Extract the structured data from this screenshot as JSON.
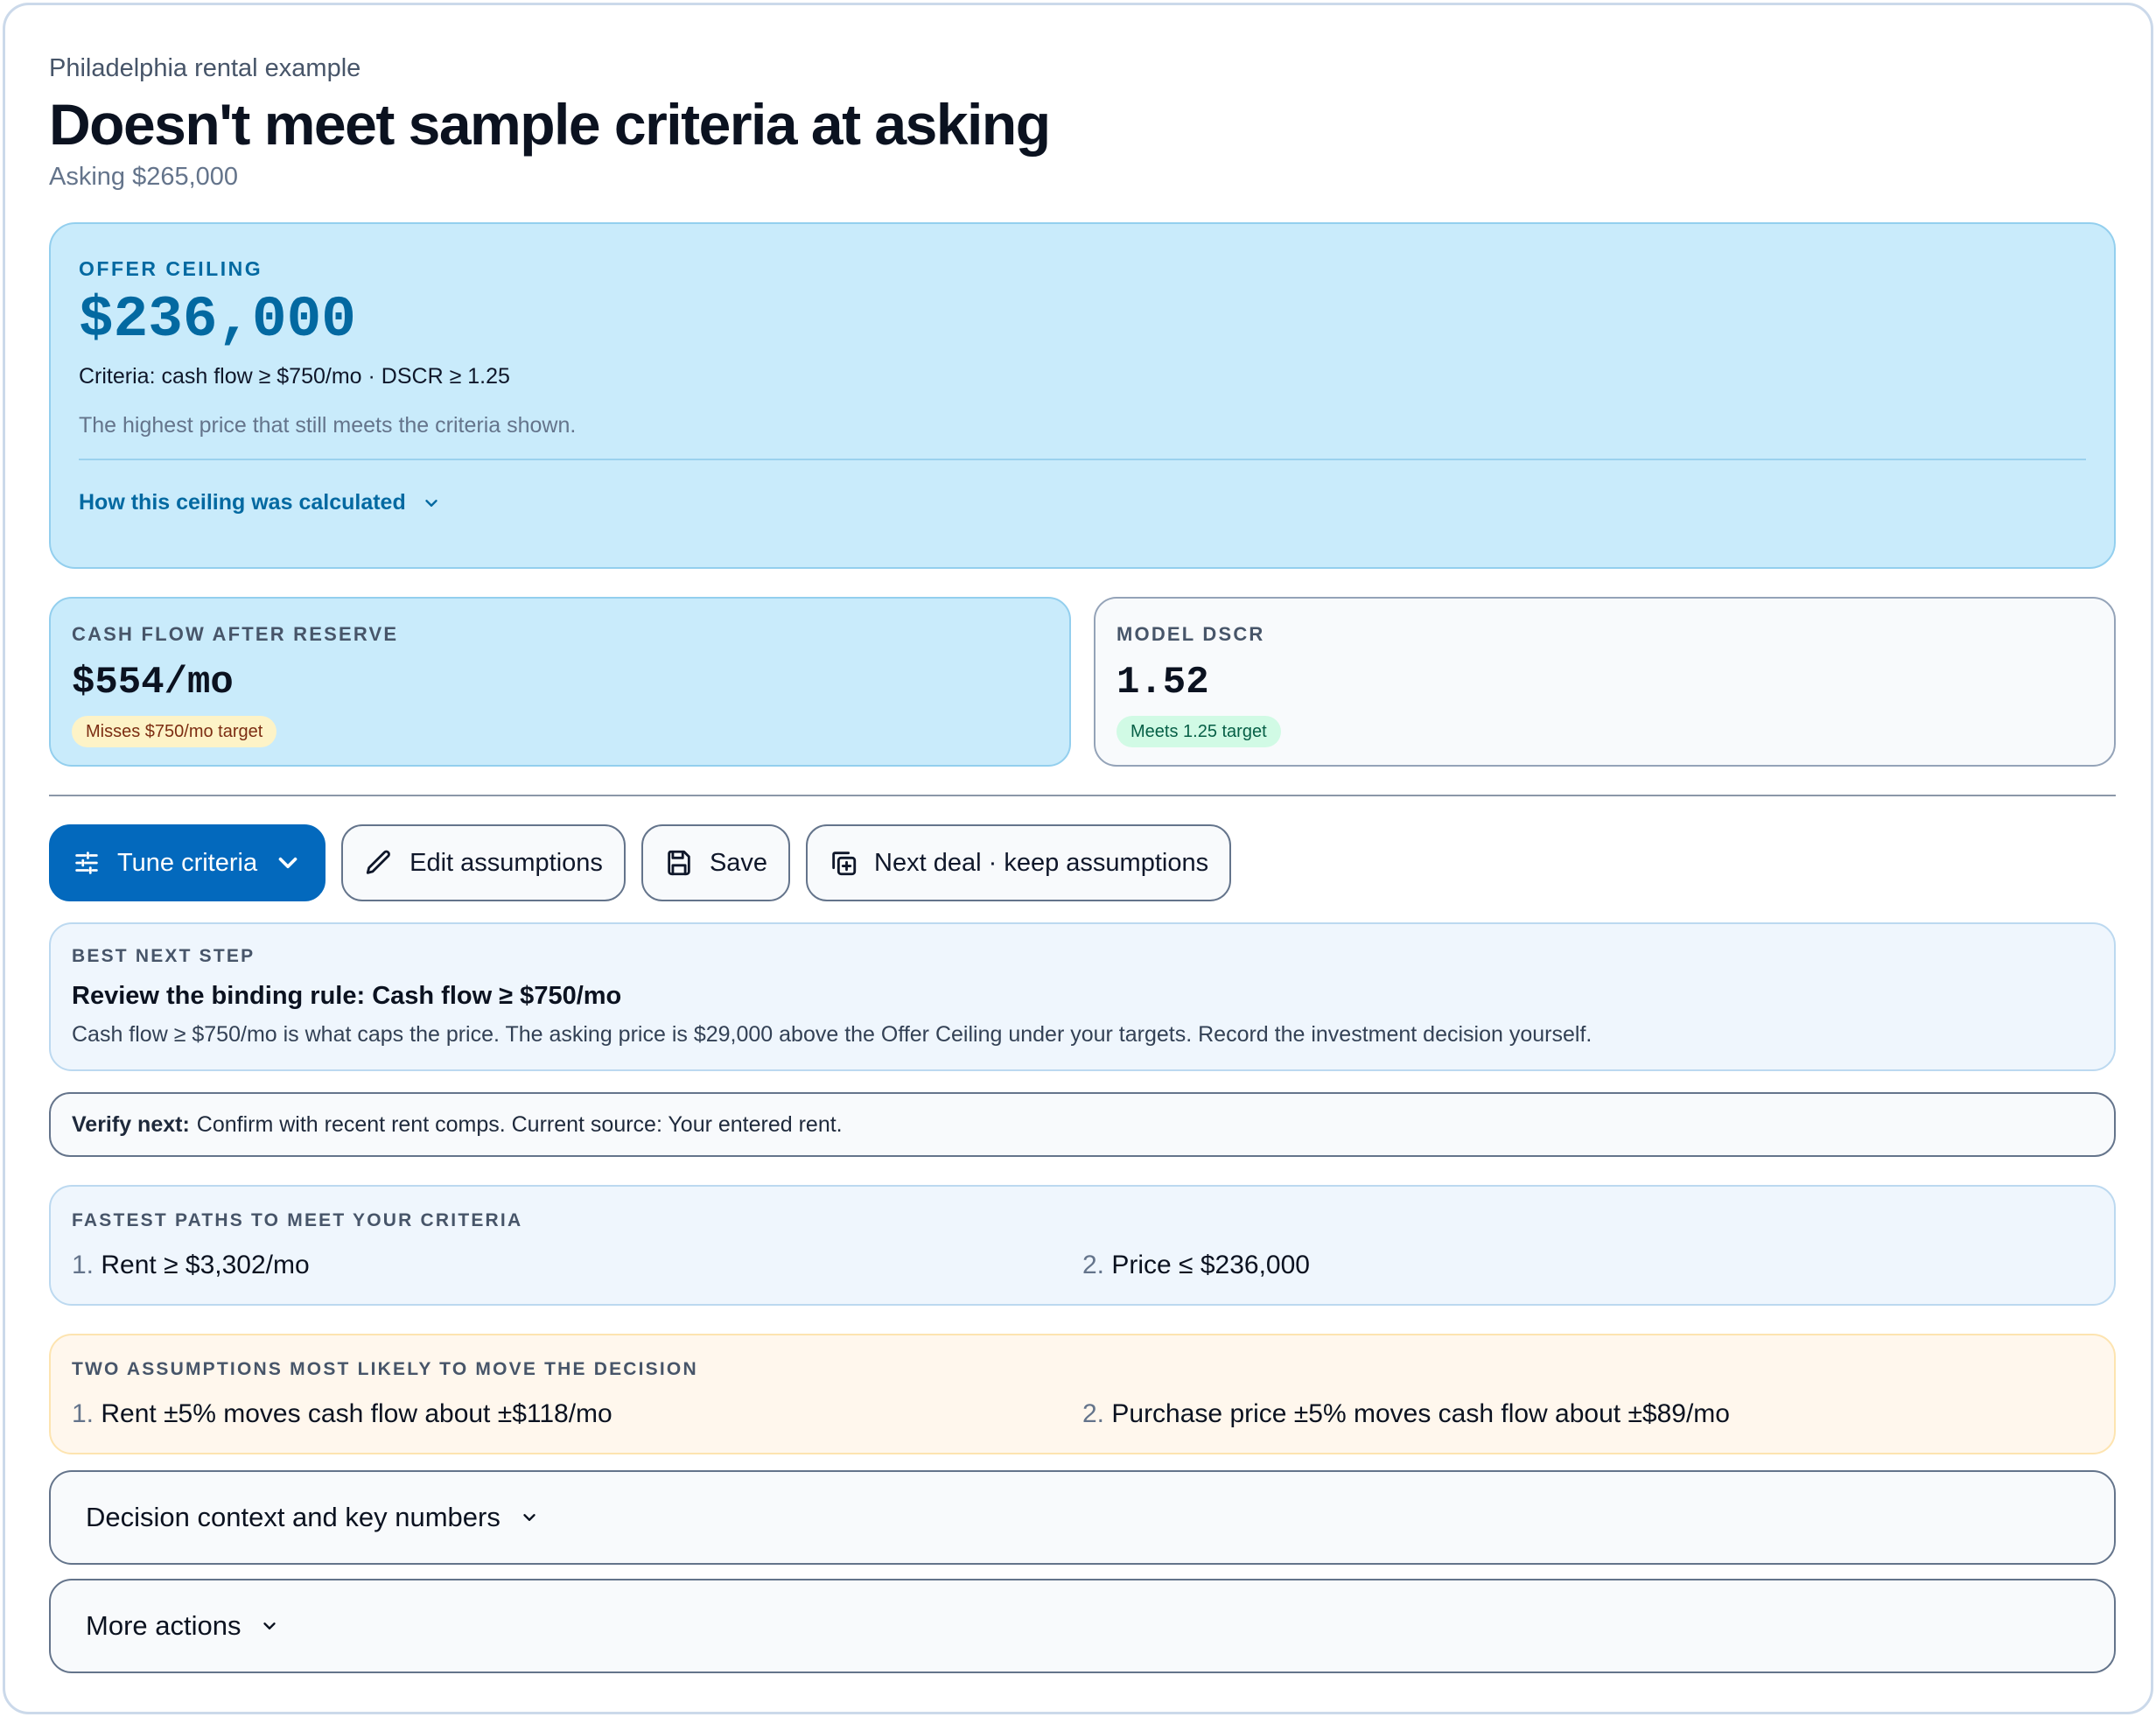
{
  "header": {
    "eyebrow": "Philadelphia rental example",
    "title": "Doesn't meet sample criteria at asking",
    "asking": "Asking $265,000"
  },
  "ceiling": {
    "label": "OFFER CEILING",
    "value": "$236,000",
    "criteria": "Criteria: cash flow ≥ $750/mo · DSCR ≥ 1.25",
    "note": "The highest price that still meets the criteria shown.",
    "toggle_label": "How this ceiling was calculated"
  },
  "metrics": {
    "cash_flow": {
      "label": "CASH FLOW AFTER RESERVE",
      "value": "$554/mo",
      "badge": "Misses $750/mo target"
    },
    "dscr": {
      "label": "MODEL DSCR",
      "value": "1.52",
      "badge": "Meets 1.25 target"
    }
  },
  "actions": {
    "tune": "Tune criteria",
    "edit": "Edit assumptions",
    "save": "Save",
    "next_deal": "Next deal · keep assumptions"
  },
  "next_step": {
    "label": "BEST NEXT STEP",
    "title": "Review the binding rule: Cash flow ≥ $750/mo",
    "body": "Cash flow ≥ $750/mo is what caps the price. The asking price is $29,000 above the Offer Ceiling under your targets. Record the investment decision yourself."
  },
  "verify": {
    "label": "Verify next:",
    "text": "Confirm with recent rent comps. Current source: Your entered rent."
  },
  "paths": {
    "label": "FASTEST PATHS TO MEET YOUR CRITERIA",
    "items": [
      {
        "num": "1.",
        "text": "Rent ≥ $3,302/mo"
      },
      {
        "num": "2.",
        "text": "Price ≤ $236,000"
      }
    ]
  },
  "assumptions": {
    "label": "TWO ASSUMPTIONS MOST LIKELY TO MOVE THE DECISION",
    "items": [
      {
        "num": "1.",
        "text": "Rent ±5% moves cash flow about ±$118/mo"
      },
      {
        "num": "2.",
        "text": "Purchase price ±5% moves cash flow about ±$89/mo"
      }
    ]
  },
  "collapsibles": {
    "context": "Decision context and key numbers",
    "more": "More actions"
  },
  "colors": {
    "accent": "#0369bd",
    "ceiling_bg": "#c9ebfb",
    "warn_badge": "#fdf3c7",
    "ok_badge": "#d1fae5"
  },
  "icons": [
    "sliders-icon",
    "chevron-down-icon",
    "pencil-icon",
    "save-icon",
    "copy-plus-icon"
  ]
}
